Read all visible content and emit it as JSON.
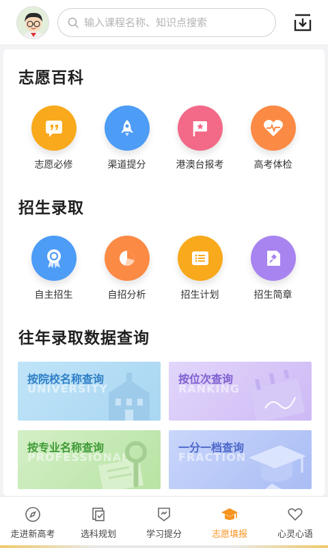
{
  "search": {
    "placeholder": "输入课程名称、知识点搜索"
  },
  "sections": {
    "encyclopedia": {
      "title": "志愿百科",
      "items": [
        {
          "label": "志愿必修",
          "icon": "quote-bubble-icon",
          "color": "#f8a91c"
        },
        {
          "label": "渠道提分",
          "icon": "rocket-icon",
          "color": "#4d9cf6"
        },
        {
          "label": "港澳台报考",
          "icon": "flag-icon",
          "color": "#f26a88"
        },
        {
          "label": "高考体检",
          "icon": "heart-pulse-icon",
          "color": "#fb8a45"
        }
      ]
    },
    "admission": {
      "title": "招生录取",
      "items": [
        {
          "label": "自主招生",
          "icon": "award-badge-icon",
          "color": "#4d9cf6"
        },
        {
          "label": "自招分析",
          "icon": "pie-chart-icon",
          "color": "#fb8a45"
        },
        {
          "label": "招生计划",
          "icon": "list-icon",
          "color": "#f8a91c"
        },
        {
          "label": "招生简章",
          "icon": "document-icon",
          "color": "#a884f0"
        }
      ]
    },
    "query": {
      "title": "往年录取数据查询",
      "cards": [
        {
          "title": "按院校名称查询",
          "subtitle": "UNIVERSITY",
          "icon": "school-building-icon",
          "color": "#5aaee6",
          "title_color": "#2f7fc6"
        },
        {
          "title": "按位次查询",
          "subtitle": "RANKING",
          "icon": "calendar-icon",
          "color": "#b8a2f0",
          "title_color": "#7e5fcf"
        },
        {
          "title": "按专业名称查询",
          "subtitle": "PROFESSIONAL",
          "icon": "magnifier-icon",
          "color": "#8fd07a",
          "title_color": "#3f9a36"
        },
        {
          "title": "一分一档查询",
          "subtitle": "FRACTION",
          "icon": "graduation-cap-icon",
          "color": "#8fa8ef",
          "title_color": "#4b67c9"
        }
      ]
    }
  },
  "tabs": [
    {
      "label": "走进新高考",
      "icon": "compass-icon",
      "active": false
    },
    {
      "label": "选科规划",
      "icon": "selection-icon",
      "active": false
    },
    {
      "label": "学习提分",
      "icon": "badge-chart-icon",
      "active": false
    },
    {
      "label": "志愿填报",
      "icon": "graduation-cap-icon",
      "active": true
    },
    {
      "label": "心灵心语",
      "icon": "heart-icon",
      "active": false
    }
  ],
  "colors": {
    "accent": "#f7931e"
  }
}
